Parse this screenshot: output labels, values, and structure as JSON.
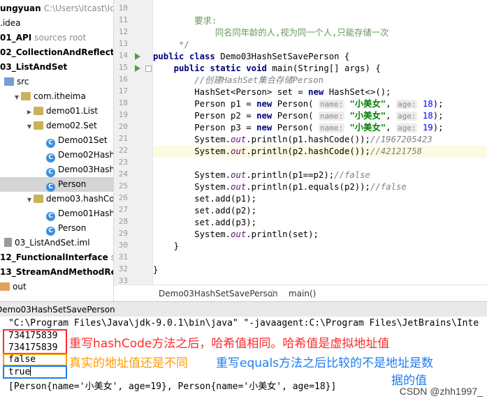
{
  "tree": {
    "items": [
      {
        "label": "ungyuan",
        "sub": "C:\\Users\\itcast\\Id",
        "bold": true,
        "icon": "none"
      },
      {
        "label": ".idea",
        "sub": "",
        "bold": false,
        "icon": "folder-icon"
      },
      {
        "label": "01_API",
        "sub": "sources root",
        "bold": true,
        "icon": "folder-icon"
      },
      {
        "label": "02_CollectionAndReflect",
        "sub": "",
        "bold": true,
        "icon": "folder-icon"
      },
      {
        "label": "03_ListAndSet",
        "sub": "",
        "bold": true,
        "icon": "folder-icon"
      },
      {
        "label": "src",
        "sub": "",
        "bold": false,
        "icon": "source-folder-icon"
      },
      {
        "label": "com.itheima",
        "sub": "",
        "bold": false,
        "icon": "package-icon"
      },
      {
        "label": "demo01.List",
        "sub": "",
        "bold": false,
        "icon": "package-icon"
      },
      {
        "label": "demo02.Set",
        "sub": "",
        "bold": false,
        "icon": "package-icon"
      },
      {
        "label": "Demo01Set",
        "sub": "",
        "bold": false,
        "icon": "class-icon"
      },
      {
        "label": "Demo02Hash",
        "sub": "",
        "bold": false,
        "icon": "class-icon"
      },
      {
        "label": "Demo03Hash",
        "sub": "",
        "bold": false,
        "icon": "class-icon"
      },
      {
        "label": "Person",
        "sub": "",
        "bold": false,
        "icon": "class-icon"
      },
      {
        "label": "demo03.hashCo",
        "sub": "",
        "bold": false,
        "icon": "package-icon"
      },
      {
        "label": "Demo01Hash",
        "sub": "",
        "bold": false,
        "icon": "class-icon"
      },
      {
        "label": "Person",
        "sub": "",
        "bold": false,
        "icon": "class-icon"
      },
      {
        "label": "03_ListAndSet.iml",
        "sub": "",
        "bold": false,
        "icon": "iml-file-icon"
      },
      {
        "label": "12_FunctionalInterface",
        "sub": "sc",
        "bold": true,
        "icon": "folder-icon"
      },
      {
        "label": "13_StreamAndMethodRef",
        "sub": "",
        "bold": true,
        "icon": "folder-icon"
      },
      {
        "label": "out",
        "sub": "",
        "bold": false,
        "icon": "output-folder-icon"
      }
    ]
  },
  "editor": {
    "line_numbers": [
      "10",
      "11",
      "12",
      "13",
      "14",
      "15",
      "16",
      "17",
      "18",
      "19",
      "20",
      "21",
      "22",
      "23",
      "24",
      "25",
      "26",
      "27",
      "28",
      "29",
      "30",
      "31",
      "32",
      "33"
    ],
    "code": {
      "l11_doc": "        要求:",
      "l12_doc": "            同名同年龄的人,视为同一个人,只能存储一次",
      "l13_doc": "     */",
      "l14_kw1": "public class ",
      "l14_rest": "Demo03HashSetSavePerson {",
      "l15_kw": "public static void ",
      "l15_rest": "main(String[] args) {",
      "l16_cm": "//创建HashSet集合存储Person",
      "l17_a": "HashSet<Person> set = ",
      "l17_kw": "new ",
      "l17_b": "HashSet<>();",
      "p1_a": "Person p1 = ",
      "p2_a": "Person p2 = ",
      "p3_a": "Person p3 = ",
      "new_kw": "new ",
      "person_ctor": "Person(",
      "hint_name": "name:",
      "str_name": "\"小美女\"",
      "hint_age": "age:",
      "age1": "18",
      "age2": "18",
      "age3": "19",
      "end_call": ");",
      "sys": "System.",
      "out": "out",
      "l21_b": ".println(p1.hashCode());",
      "l21_cm": "//1967205423",
      "l22_b": ".println(p2.hashCode());",
      "l22_cm": "//42121758",
      "l24_b": ".println(p1==p2);",
      "l24_cm": "//false",
      "l25_b": ".println(p1.equals(p2));",
      "l25_cm": "//false",
      "l26": "set.add(p1);",
      "l27": "set.add(p2);",
      "l28": "set.add(p3);",
      "l29_b": ".println(set);",
      "close_inner": "}",
      "close_outer": "}"
    }
  },
  "breadcrumb": {
    "class_name": "Demo03HashSetSavePerson",
    "method": "main()"
  },
  "run": {
    "title": "Demo03HashSetSavePerson",
    "command": "\"C:\\Program Files\\Java\\jdk-9.0.1\\bin\\java\" \"-javaagent:C:\\Program Files\\JetBrains\\Inte",
    "out1": "734175839",
    "out2": "734175839",
    "out3": "false",
    "out4": "true",
    "out5": "[Person{name='小美女', age=19}, Person{name='小美女', age=18}]"
  },
  "annotations": {
    "note1": "重写hashCode方法之后，哈希值相同。哈希值是虚拟地址值",
    "note2a": "真实的地址值还是不同",
    "note2b": "重写equals方法之后比较的不是地址是数",
    "note2c": "据的值",
    "colors": {
      "red": "#ff2a2a",
      "orange": "#ff9a00",
      "blue": "#1e7cf0"
    }
  },
  "watermark": "CSDN @zhh1997_"
}
